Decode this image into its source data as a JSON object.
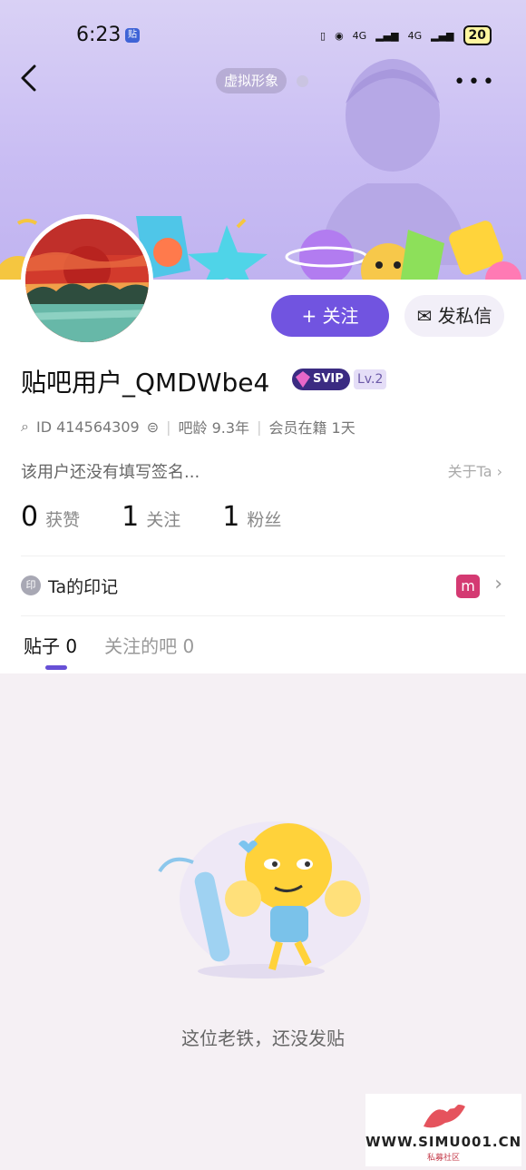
{
  "status_bar": {
    "time": "6:23",
    "app_badge": "贴",
    "network1": "4G",
    "network2": "4G",
    "battery": "20"
  },
  "header": {
    "virtual_tag": "虚拟形象",
    "more": "•••"
  },
  "profile": {
    "username": "贴吧用户_QMDWbe4",
    "svip": "SVIP",
    "level": "Lv.2",
    "id_text": "ID 414564309",
    "age_text": "吧龄 9.3年",
    "member_text": "会员在籍 1天",
    "bio": "该用户还没有填写签名...",
    "about": "关于Ta",
    "follow_button": "+ 关注",
    "dm_button": "发私信"
  },
  "stats": [
    {
      "value": "0",
      "label": "获赞"
    },
    {
      "value": "1",
      "label": "关注"
    },
    {
      "value": "1",
      "label": "粉丝"
    }
  ],
  "imprint": {
    "icon_text": "印",
    "label": "Ta的印记",
    "badge": "m"
  },
  "tabs": [
    {
      "label": "贴子 0"
    },
    {
      "label": "关注的吧 0"
    }
  ],
  "empty_state": {
    "text": "这位老铁，还没发贴"
  },
  "watermark": {
    "site": "WWW.SIMU001.CN",
    "sub": "私募社区"
  },
  "colors": {
    "accent": "#7154e0",
    "header_bg": "#c9bdf3",
    "svip": "#3b2b82",
    "page_bg": "#f5f0f4"
  }
}
